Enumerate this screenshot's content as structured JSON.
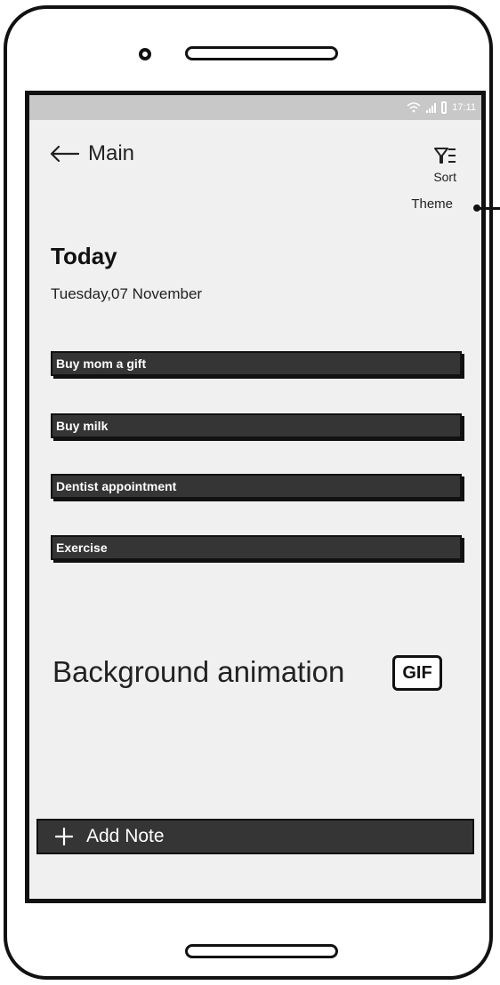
{
  "status_bar": {
    "time": "17:11",
    "icons": [
      "wifi-icon",
      "signal-icon",
      "battery-icon"
    ]
  },
  "header": {
    "back_icon": "arrow-left-icon",
    "title": "Main"
  },
  "sort": {
    "icon": "filter-sort-icon",
    "label": "Sort"
  },
  "theme": {
    "label": "Theme"
  },
  "today": {
    "heading": "Today",
    "date": "Tuesday,07 November"
  },
  "notes": [
    {
      "label": "Buy mom a gift"
    },
    {
      "label": "Buy milk"
    },
    {
      "label": "Dentist appointment"
    },
    {
      "label": "Exercise"
    }
  ],
  "background": {
    "label": "Background animation",
    "badge": "GIF"
  },
  "add_note": {
    "icon": "plus-icon",
    "label": "Add Note"
  },
  "colors": {
    "note_bg": "#353535",
    "screen_bg": "#f0f0f0",
    "status_bg": "#c8c8c8"
  }
}
